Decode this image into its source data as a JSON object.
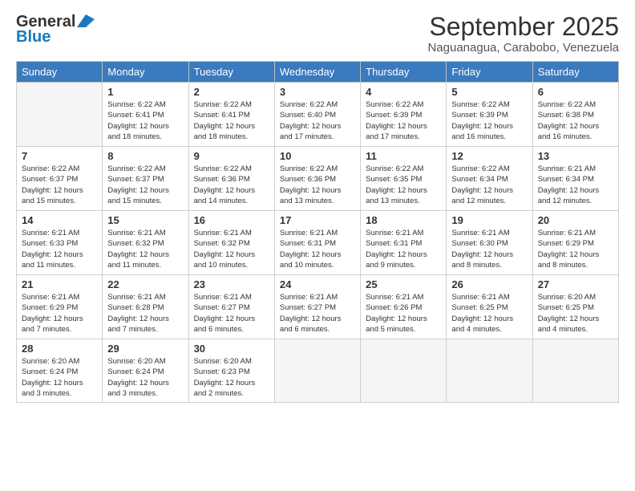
{
  "logo": {
    "line1": "General",
    "line2": "Blue"
  },
  "title": "September 2025",
  "location": "Naguanagua, Carabobo, Venezuela",
  "days_header": [
    "Sunday",
    "Monday",
    "Tuesday",
    "Wednesday",
    "Thursday",
    "Friday",
    "Saturday"
  ],
  "weeks": [
    [
      {
        "day": "",
        "info": ""
      },
      {
        "day": "1",
        "info": "Sunrise: 6:22 AM\nSunset: 6:41 PM\nDaylight: 12 hours\nand 18 minutes."
      },
      {
        "day": "2",
        "info": "Sunrise: 6:22 AM\nSunset: 6:41 PM\nDaylight: 12 hours\nand 18 minutes."
      },
      {
        "day": "3",
        "info": "Sunrise: 6:22 AM\nSunset: 6:40 PM\nDaylight: 12 hours\nand 17 minutes."
      },
      {
        "day": "4",
        "info": "Sunrise: 6:22 AM\nSunset: 6:39 PM\nDaylight: 12 hours\nand 17 minutes."
      },
      {
        "day": "5",
        "info": "Sunrise: 6:22 AM\nSunset: 6:39 PM\nDaylight: 12 hours\nand 16 minutes."
      },
      {
        "day": "6",
        "info": "Sunrise: 6:22 AM\nSunset: 6:38 PM\nDaylight: 12 hours\nand 16 minutes."
      }
    ],
    [
      {
        "day": "7",
        "info": "Sunrise: 6:22 AM\nSunset: 6:37 PM\nDaylight: 12 hours\nand 15 minutes."
      },
      {
        "day": "8",
        "info": "Sunrise: 6:22 AM\nSunset: 6:37 PM\nDaylight: 12 hours\nand 15 minutes."
      },
      {
        "day": "9",
        "info": "Sunrise: 6:22 AM\nSunset: 6:36 PM\nDaylight: 12 hours\nand 14 minutes."
      },
      {
        "day": "10",
        "info": "Sunrise: 6:22 AM\nSunset: 6:36 PM\nDaylight: 12 hours\nand 13 minutes."
      },
      {
        "day": "11",
        "info": "Sunrise: 6:22 AM\nSunset: 6:35 PM\nDaylight: 12 hours\nand 13 minutes."
      },
      {
        "day": "12",
        "info": "Sunrise: 6:22 AM\nSunset: 6:34 PM\nDaylight: 12 hours\nand 12 minutes."
      },
      {
        "day": "13",
        "info": "Sunrise: 6:21 AM\nSunset: 6:34 PM\nDaylight: 12 hours\nand 12 minutes."
      }
    ],
    [
      {
        "day": "14",
        "info": "Sunrise: 6:21 AM\nSunset: 6:33 PM\nDaylight: 12 hours\nand 11 minutes."
      },
      {
        "day": "15",
        "info": "Sunrise: 6:21 AM\nSunset: 6:32 PM\nDaylight: 12 hours\nand 11 minutes."
      },
      {
        "day": "16",
        "info": "Sunrise: 6:21 AM\nSunset: 6:32 PM\nDaylight: 12 hours\nand 10 minutes."
      },
      {
        "day": "17",
        "info": "Sunrise: 6:21 AM\nSunset: 6:31 PM\nDaylight: 12 hours\nand 10 minutes."
      },
      {
        "day": "18",
        "info": "Sunrise: 6:21 AM\nSunset: 6:31 PM\nDaylight: 12 hours\nand 9 minutes."
      },
      {
        "day": "19",
        "info": "Sunrise: 6:21 AM\nSunset: 6:30 PM\nDaylight: 12 hours\nand 8 minutes."
      },
      {
        "day": "20",
        "info": "Sunrise: 6:21 AM\nSunset: 6:29 PM\nDaylight: 12 hours\nand 8 minutes."
      }
    ],
    [
      {
        "day": "21",
        "info": "Sunrise: 6:21 AM\nSunset: 6:29 PM\nDaylight: 12 hours\nand 7 minutes."
      },
      {
        "day": "22",
        "info": "Sunrise: 6:21 AM\nSunset: 6:28 PM\nDaylight: 12 hours\nand 7 minutes."
      },
      {
        "day": "23",
        "info": "Sunrise: 6:21 AM\nSunset: 6:27 PM\nDaylight: 12 hours\nand 6 minutes."
      },
      {
        "day": "24",
        "info": "Sunrise: 6:21 AM\nSunset: 6:27 PM\nDaylight: 12 hours\nand 6 minutes."
      },
      {
        "day": "25",
        "info": "Sunrise: 6:21 AM\nSunset: 6:26 PM\nDaylight: 12 hours\nand 5 minutes."
      },
      {
        "day": "26",
        "info": "Sunrise: 6:21 AM\nSunset: 6:25 PM\nDaylight: 12 hours\nand 4 minutes."
      },
      {
        "day": "27",
        "info": "Sunrise: 6:20 AM\nSunset: 6:25 PM\nDaylight: 12 hours\nand 4 minutes."
      }
    ],
    [
      {
        "day": "28",
        "info": "Sunrise: 6:20 AM\nSunset: 6:24 PM\nDaylight: 12 hours\nand 3 minutes."
      },
      {
        "day": "29",
        "info": "Sunrise: 6:20 AM\nSunset: 6:24 PM\nDaylight: 12 hours\nand 3 minutes."
      },
      {
        "day": "30",
        "info": "Sunrise: 6:20 AM\nSunset: 6:23 PM\nDaylight: 12 hours\nand 2 minutes."
      },
      {
        "day": "",
        "info": ""
      },
      {
        "day": "",
        "info": ""
      },
      {
        "day": "",
        "info": ""
      },
      {
        "day": "",
        "info": ""
      }
    ]
  ]
}
